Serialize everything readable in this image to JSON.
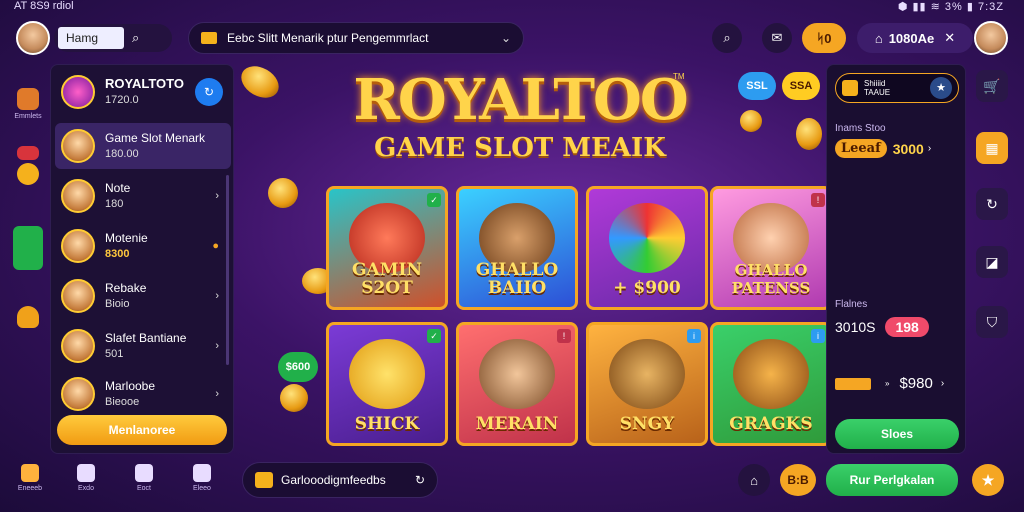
{
  "statusbar": {
    "left": "AT 8S9 rdiol",
    "right": "⬢ ▮▮ ≋ 3% ▮ 7:3Z"
  },
  "topbar": {
    "home_label": "Hamg",
    "search_text": "Eebc Slitt Menarik ptur Pengemmrlact",
    "coins_label": "ᛋ0",
    "balance_label": "1080Ae"
  },
  "sidebar_left": {
    "items": [
      {
        "label": "Emmlets"
      },
      {
        "label": ""
      },
      {
        "label": ""
      },
      {
        "label": ""
      }
    ]
  },
  "game_list": {
    "header": {
      "title": "ROYALTOTO",
      "sub": "1720.0"
    },
    "rows": [
      {
        "title": "Game Slot Menark",
        "sub": "180.00"
      },
      {
        "title": "Note",
        "sub": "180"
      },
      {
        "title": "Motenie",
        "sub": "8300"
      },
      {
        "title": "Rebake",
        "sub": "Bioio"
      },
      {
        "title": "Slafet Bantiane",
        "sub": "501"
      },
      {
        "title": "Marloobe",
        "sub": "Bieooe"
      }
    ],
    "cta_label": "Menlanoree"
  },
  "hero": {
    "title": "ROYALTOO",
    "subtitle": "GAME SLOT MEAIK",
    "tm": "TM"
  },
  "tiles": [
    {
      "label": "GAMIN\nS2OT",
      "color": "#d0502a"
    },
    {
      "label": "GHALLO\nBAIIO",
      "color": "#2d4fd6"
    },
    {
      "label": "+ $900",
      "color": "#6a2aa8"
    },
    {
      "label": "GHALLO\nPATENSS",
      "color": "#b03ab0"
    },
    {
      "label": "SHICK",
      "color": "#4a1e8e"
    },
    {
      "label": "MERAIN",
      "color": "#c0324a"
    },
    {
      "label": "SNGY",
      "color": "#b8621a"
    },
    {
      "label": "GRAGKS",
      "color": "#2f9a3a"
    }
  ],
  "chips": {
    "a": "SSL",
    "b": "SSA"
  },
  "right_panel": {
    "header": "Shiiiid\nTAAUE",
    "label1": "Inams Stoo",
    "amount1_label": "Leeaf",
    "amount1": "3000",
    "label2": "Flalnes",
    "amount2_label": "3010S",
    "amount2": "198",
    "amount3": "$980",
    "button": "Sloes"
  },
  "left_promo": {
    "amount": "$600"
  },
  "bottom": {
    "nav": [
      {
        "label": "Eneeeb"
      },
      {
        "label": "Exdo"
      },
      {
        "label": "Eoct"
      },
      {
        "label": "Eleeo"
      }
    ],
    "search_text": "Garlooodigmfeedbs",
    "chip": "B:B",
    "play_label": "Rur Perlgkalan"
  },
  "colors": {
    "accent": "#f5a623",
    "primary_bg": "#3b1366",
    "green": "#21b04a"
  }
}
